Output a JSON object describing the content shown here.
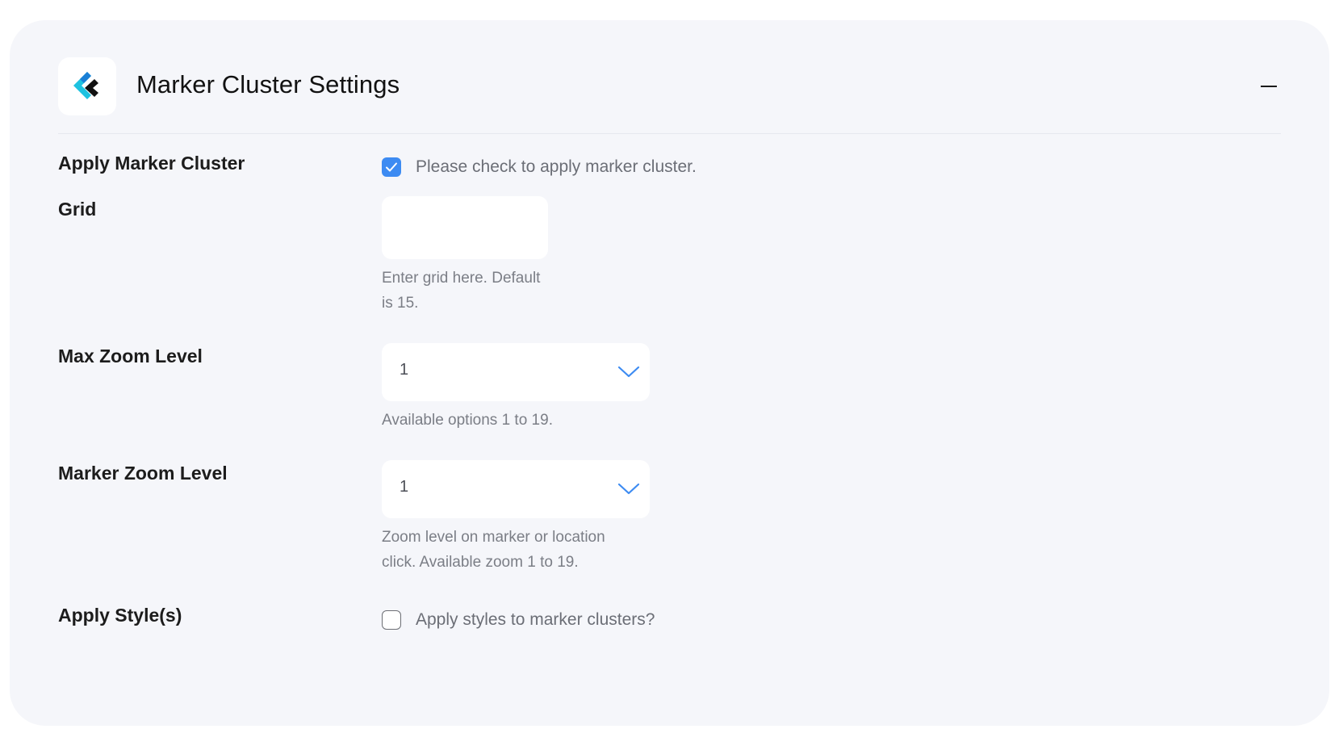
{
  "header": {
    "title": "Marker Cluster Settings",
    "logo_icon": "chevron-logo-icon",
    "collapse_icon": "minus-icon"
  },
  "colors": {
    "accent": "#3d8bf2",
    "logo_cyan": "#1ec2e0",
    "logo_blue": "#1a7fd6",
    "logo_dark": "#111111"
  },
  "fields": {
    "apply_marker_cluster": {
      "label": "Apply Marker Cluster",
      "checkbox_text": "Please check to apply marker cluster.",
      "checked": true
    },
    "grid": {
      "label": "Grid",
      "value": "",
      "help_line1": "Enter grid here. Default",
      "help_line2": "is 15."
    },
    "max_zoom_level": {
      "label": "Max Zoom Level",
      "selected": "1",
      "help": "Available options 1 to 19."
    },
    "marker_zoom_level": {
      "label": "Marker Zoom Level",
      "selected": "1",
      "help_line1": "Zoom level on marker or location",
      "help_line2": "click. Available zoom 1 to 19."
    },
    "apply_styles": {
      "label": "Apply Style(s)",
      "checkbox_text": "Apply styles to marker clusters?",
      "checked": false
    }
  }
}
